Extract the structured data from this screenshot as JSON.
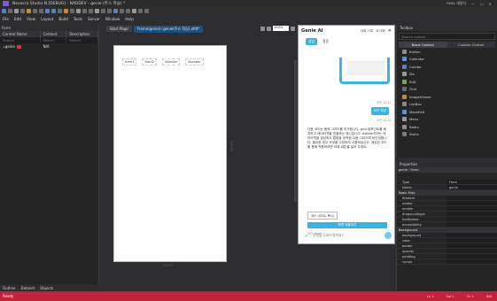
{
  "window": {
    "title": "Nexacro Studio N [DEBUG] - NXODEV - genie (주스 학습) *",
    "user": "nexa 개발자",
    "buttons": [
      "—",
      "☐",
      "✕"
    ]
  },
  "menu": [
    "File",
    "Edit",
    "View",
    "Layout",
    "Build",
    "Tools",
    "Server",
    "Window",
    "Help"
  ],
  "left_panel": {
    "title": "Form",
    "columns": [
      "Control Name",
      "Content",
      "Description"
    ],
    "search": [
      "Search",
      "Search",
      "Search"
    ],
    "rows": [
      {
        "name": "genie",
        "content": "N/A",
        "description": ""
      }
    ],
    "bottom_tabs": [
      "Outline",
      "Dataset",
      "Objects"
    ]
  },
  "center": {
    "tabs": [
      "Start Page",
      "Frame(genie)::genie(주스 학습).xfdl*"
    ],
    "zoom": "100%",
    "canvas_columns": [
      "Item1",
      "Item2",
      "Number",
      "Number"
    ]
  },
  "genie": {
    "title": "Genie AI",
    "header_actions": [
      "대화 기록",
      "새 대화"
    ],
    "tabs": [
      "생성",
      "질문"
    ],
    "time1": "오전 10:21",
    "user_message": "코드 작성",
    "time2": "오전 10:21",
    "bot_message": "다음 코드는 폼에 그리드를 추가합니다. grid 컴포넌트를 배치하고 데이터셋을 연결하는 예시입니다. dsItem이라는 데이터셋을 생성하고 컬럼을 정의한 다음 그리드에 바인딩합니다. 필요한 경우 속성을 수정하여 사용하십시오. 생성된 코드를 폼에 적용하려면 아래 버튼을 눌러 주세요.",
    "code_chip": "코드 (XFDL 복사)",
    "apply_label": "화면 적용하기",
    "time3": "오전 10:21",
    "input_placeholder": "무엇을 도와드릴까요?"
  },
  "toolbox": {
    "title": "Toolbox",
    "search_placeholder": "Search control",
    "tabs": [
      "Basic Control",
      "Custom Control"
    ],
    "items": [
      "Button",
      "Calendar",
      "Combo",
      "Div",
      "Edit",
      "Grid",
      "ImageViewer",
      "ListBox",
      "MaskEdit",
      "Menu",
      "Radio",
      "Static"
    ]
  },
  "properties": {
    "title": "Properties",
    "object": "genie : Form",
    "rows": [
      {
        "k": "Type",
        "v": "Form"
      },
      {
        "k": "Name",
        "v": "genie"
      }
    ],
    "category1": "Basic Misc",
    "rows2": [
      {
        "k": "titletext",
        "v": ""
      },
      {
        "k": "visible",
        "v": ""
      },
      {
        "k": "enable",
        "v": ""
      },
      {
        "k": "dragscrolltype",
        "v": ""
      },
      {
        "k": "tooltiptext",
        "v": ""
      },
      {
        "k": "accessibility",
        "v": ""
      }
    ],
    "category2": "Background",
    "rows3": [
      {
        "k": "background",
        "v": ""
      },
      {
        "k": "color",
        "v": ""
      },
      {
        "k": "border",
        "v": ""
      },
      {
        "k": "opacity",
        "v": ""
      },
      {
        "k": "padding",
        "v": ""
      },
      {
        "k": "cursor",
        "v": ""
      }
    ]
  },
  "status": {
    "left": "Ready",
    "right": [
      "Ln 1",
      "Col 1",
      "Ch 1",
      "INS"
    ]
  }
}
